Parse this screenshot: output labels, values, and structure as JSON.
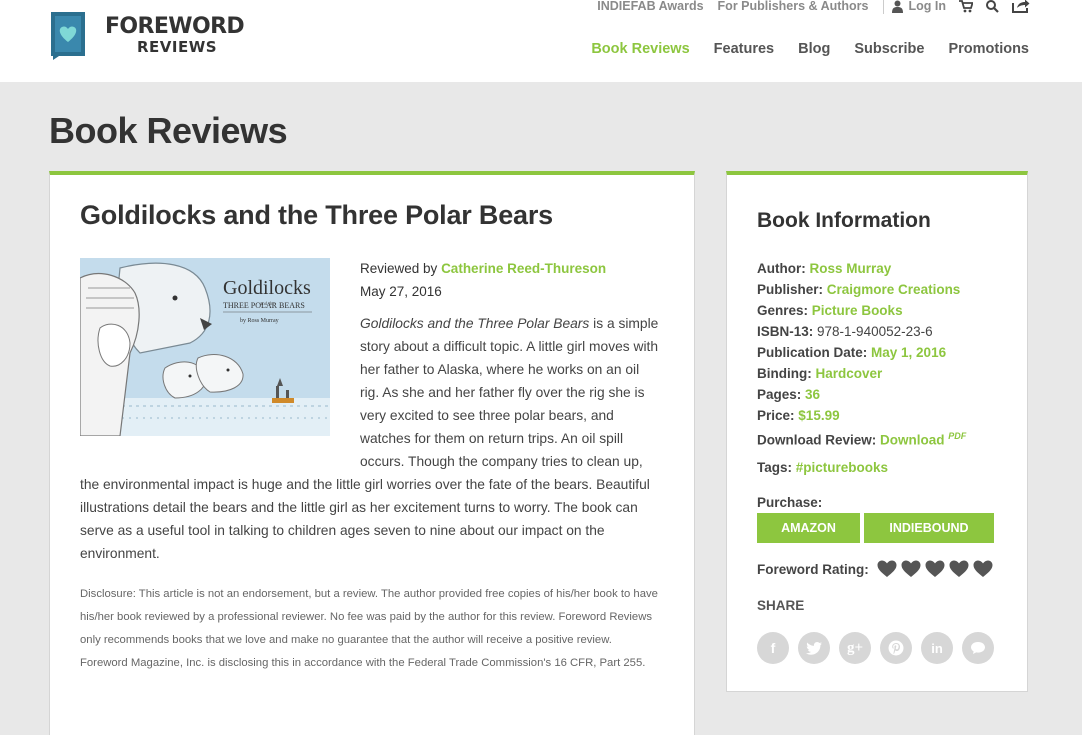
{
  "brand": {
    "name_line1": "FOREWORD",
    "name_line2": "REVIEWS",
    "color": "#8dc63f",
    "logo_color": "#2b6f8f"
  },
  "utility_nav": {
    "indiefab": "INDIEFAB Awards",
    "publishers": "For Publishers & Authors",
    "login": "Log In"
  },
  "main_nav": [
    {
      "label": "Book Reviews",
      "active": true
    },
    {
      "label": "Features",
      "active": false
    },
    {
      "label": "Blog",
      "active": false
    },
    {
      "label": "Subscribe",
      "active": false
    },
    {
      "label": "Promotions",
      "active": false
    }
  ],
  "page_title": "Book Reviews",
  "review": {
    "title": "Goldilocks and the Three Polar Bears",
    "cover": {
      "title": "Goldilocks",
      "and": "and the",
      "subtitle": "THREE POLAR BEARS",
      "author": "by Ross Murray"
    },
    "reviewed_by_label": "Reviewed by",
    "reviewer": "Catherine Reed-Thureson",
    "date": "May 27, 2016",
    "body_title_italic": "Goldilocks and the Three Polar Bears",
    "body": " is a simple story about a difficult topic. A little girl moves with her father to Alaska, where he works on an oil rig. As she and her father fly over the rig she is very excited to see three polar bears, and watches for them on return trips. An oil spill occurs. Though the company tries to clean up, the environmental impact is huge and the little girl worries over the fate of the bears. Beautiful illustrations detail the bears and the little girl as her excitement turns to worry. The book can serve as a useful tool in talking to children ages seven to nine about our impact on the environment.",
    "disclosure": "Disclosure: This article is not an endorsement, but a review. The author provided free copies of his/her book to have his/her book reviewed by a professional reviewer. No fee was paid by the author for this review. Foreword Reviews only recommends books that we love and make no guarantee that the author will receive a positive review. Foreword Magazine, Inc. is disclosing this in accordance with the Federal Trade Commission's 16 CFR, Part 255."
  },
  "book_info": {
    "heading": "Book Information",
    "rows": [
      {
        "label": "Author:",
        "value": "Ross Murray",
        "link": true
      },
      {
        "label": "Publisher:",
        "value": "Craigmore Creations",
        "link": true
      },
      {
        "label": "Genres:",
        "value": "Picture Books",
        "link": true
      },
      {
        "label": "ISBN-13:",
        "value": "978-1-940052-23-6",
        "link": false
      },
      {
        "label": "Publication Date:",
        "value": "May 1, 2016",
        "link": true
      },
      {
        "label": "Binding:",
        "value": "Hardcover",
        "link": true
      },
      {
        "label": "Pages:",
        "value": "36",
        "link": true
      },
      {
        "label": "Price:",
        "value": "$15.99",
        "link": true
      },
      {
        "label": "Download Review:",
        "value": "Download",
        "link": true,
        "sup": "PDF"
      }
    ],
    "tags_label": "Tags:",
    "tags_value": "#picturebooks",
    "purchase_label": "Purchase:",
    "buy_amazon": "AMAZON",
    "buy_indiebound": "INDIEBOUND",
    "rating_label": "Foreword Rating:",
    "rating": 5,
    "share_label": "SHARE",
    "share_icons": [
      {
        "name": "facebook-icon",
        "glyph": "f"
      },
      {
        "name": "twitter-icon",
        "glyph": "t"
      },
      {
        "name": "google-plus-icon",
        "glyph": "g+"
      },
      {
        "name": "pinterest-icon",
        "glyph": "p"
      },
      {
        "name": "linkedin-icon",
        "glyph": "in"
      },
      {
        "name": "comment-icon",
        "glyph": ""
      }
    ]
  }
}
